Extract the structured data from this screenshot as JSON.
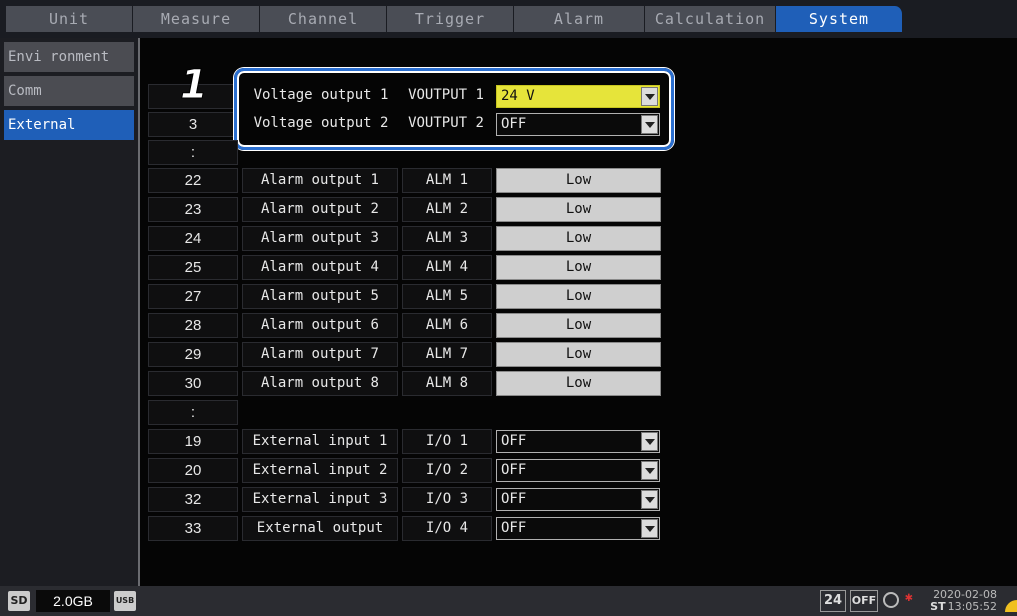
{
  "tabs": [
    {
      "label": "Unit"
    },
    {
      "label": "Measure"
    },
    {
      "label": "Channel"
    },
    {
      "label": "Trigger"
    },
    {
      "label": "Alarm"
    },
    {
      "label": "Calculation"
    },
    {
      "label": "System"
    }
  ],
  "sidebar": {
    "items": [
      {
        "label": "Envi ronment"
      },
      {
        "label": "Comm"
      },
      {
        "label": "External"
      }
    ]
  },
  "step_marker": "1",
  "voltage_outputs": [
    {
      "pin": "",
      "name": "Voltage output 1",
      "code": "VOUTPUT 1",
      "value": "24 V"
    },
    {
      "pin": "3",
      "name": "Voltage output 2",
      "code": "VOUTPUT 2",
      "value": "OFF"
    }
  ],
  "separators": [
    ":",
    ":"
  ],
  "alarm_outputs": [
    {
      "pin": "22",
      "name": "Alarm output 1",
      "code": "ALM 1",
      "value": "Low"
    },
    {
      "pin": "23",
      "name": "Alarm output 2",
      "code": "ALM 2",
      "value": "Low"
    },
    {
      "pin": "24",
      "name": "Alarm output 3",
      "code": "ALM 3",
      "value": "Low"
    },
    {
      "pin": "25",
      "name": "Alarm output 4",
      "code": "ALM 4",
      "value": "Low"
    },
    {
      "pin": "27",
      "name": "Alarm output 5",
      "code": "ALM 5",
      "value": "Low"
    },
    {
      "pin": "28",
      "name": "Alarm output 6",
      "code": "ALM 6",
      "value": "Low"
    },
    {
      "pin": "29",
      "name": "Alarm output 7",
      "code": "ALM 7",
      "value": "Low"
    },
    {
      "pin": "30",
      "name": "Alarm output 8",
      "code": "ALM 8",
      "value": "Low"
    }
  ],
  "io_rows": [
    {
      "pin": "19",
      "name": "External input 1",
      "code": "I/O 1",
      "value": "OFF"
    },
    {
      "pin": "20",
      "name": "External input 2",
      "code": "I/O 2",
      "value": "OFF"
    },
    {
      "pin": "32",
      "name": "External input 3",
      "code": "I/O 3",
      "value": "OFF"
    },
    {
      "pin": "33",
      "name": "External output",
      "code": "I/O 4",
      "value": "OFF"
    }
  ],
  "status": {
    "sd_icon": "SD",
    "storage": "2.0GB",
    "usb_icon": "USB",
    "box1": "24",
    "box2": "OFF",
    "date": "2020-02-08",
    "time_prefix": "ST",
    "time": "13:05:52"
  },
  "colors": {
    "accent": "#1f5fb8",
    "selected_value": "#e6e43a"
  }
}
